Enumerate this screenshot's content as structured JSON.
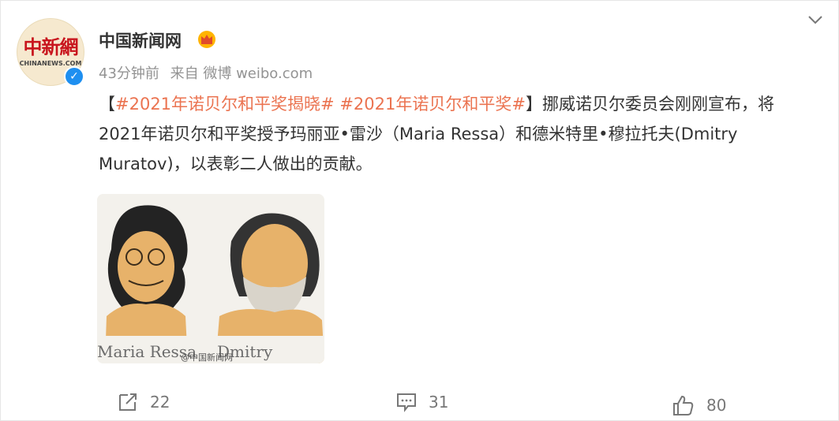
{
  "post": {
    "author": {
      "name": "中国新闻网",
      "avatar_text_cn": "中新網",
      "avatar_text_en": "CHINANEWS.COM"
    },
    "meta": {
      "time": "43分钟前",
      "source": "来自 微博 weibo.com"
    },
    "content": {
      "open_bracket": "【",
      "hashtag1": "#2021年诺贝尔和平奖揭晓#",
      "space": " ",
      "hashtag2": "#2021年诺贝尔和平奖#",
      "close_bracket_text": "】挪威诺贝尔委员会刚刚宣布，将2021年诺贝尔和平奖授予玛丽亚•雷沙（Maria Ressa）和德米特里•穆拉托夫(Dmitry Muratov)，以表彰二人做出的贡献。"
    },
    "image": {
      "caption_left": "Maria Ressa",
      "caption_right": "Dmitry Muratov",
      "watermark": "@中国新闻网"
    },
    "actions": {
      "repost_count": "22",
      "comment_count": "31",
      "like_count": "80"
    },
    "colors": {
      "hashtag": "#eb7350",
      "verified": "#1e8ff0",
      "avatar_red": "#c8151d"
    },
    "icons": [
      "more-chevron-icon",
      "crown-icon",
      "verified-icon",
      "repost-icon",
      "comment-icon",
      "like-icon"
    ]
  }
}
